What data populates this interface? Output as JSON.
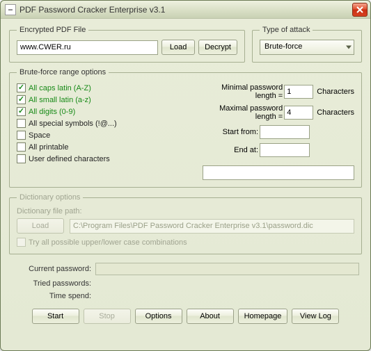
{
  "window": {
    "title": "PDF Password Cracker Enterprise v3.1"
  },
  "file_group": {
    "legend": "Encrypted PDF File",
    "path_value": "www.CWER.ru",
    "load_btn": "Load",
    "decrypt_btn": "Decrypt"
  },
  "attack_group": {
    "legend": "Type of attack",
    "selected": "Brute-force"
  },
  "brute_group": {
    "legend": "Brute-force range options",
    "checks": [
      {
        "label": "All caps latin (A-Z)",
        "checked": true
      },
      {
        "label": "All small latin (a-z)",
        "checked": true
      },
      {
        "label": "All digits (0-9)",
        "checked": true
      },
      {
        "label": "All special symbols (!@...)",
        "checked": false
      },
      {
        "label": "Space",
        "checked": false
      },
      {
        "label": "All printable",
        "checked": false
      },
      {
        "label": "User defined characters",
        "checked": false
      }
    ],
    "min_label": "Minimal password length =",
    "min_value": "1",
    "max_label": "Maximal password length =",
    "max_value": "4",
    "characters_suffix": "Characters",
    "start_from_label": "Start from:",
    "start_from_value": "",
    "end_at_label": "End at:",
    "end_at_value": ""
  },
  "dict_group": {
    "legend": "Dictionary options",
    "file_label": "Dictionary file path:",
    "load_btn": "Load",
    "path_value": "C:\\Program Files\\PDF Password Cracker Enterprise v3.1\\password.dic",
    "caps_label": "Try all possible upper/lower case combinations"
  },
  "status": {
    "current_label": "Current password:",
    "tried_label": "Tried passwords:",
    "time_label": "Time spend:"
  },
  "buttons": {
    "start": "Start",
    "stop": "Stop",
    "options": "Options",
    "about": "About",
    "homepage": "Homepage",
    "viewlog": "View Log"
  }
}
